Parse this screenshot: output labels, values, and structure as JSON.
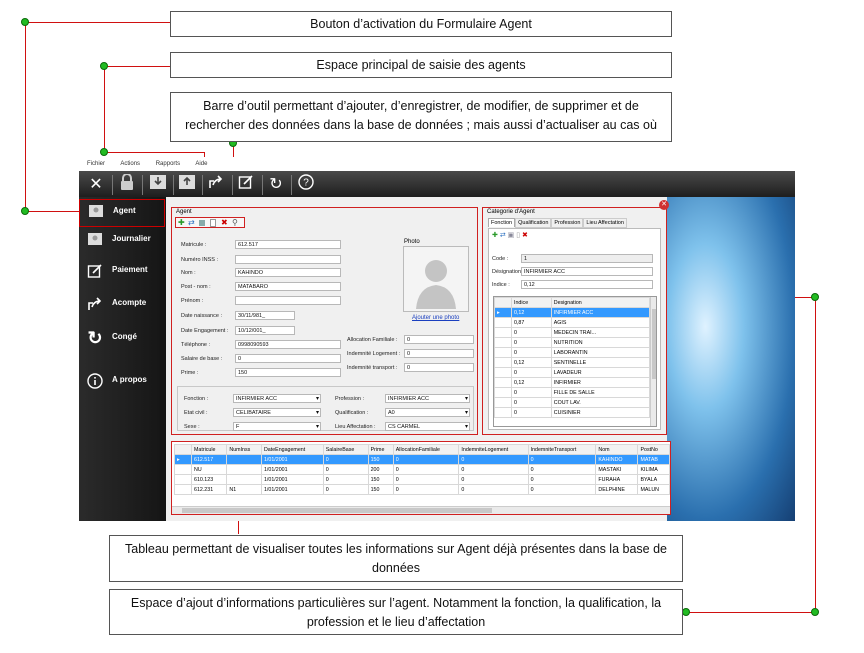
{
  "callouts": {
    "c1": "Bouton d’activation du Formulaire Agent",
    "c2": "Espace principal de saisie des agents",
    "c3_line1": "Barre d’outil permettant d’ajouter,  d’enregistrer, de modifier, de supprimer et de",
    "c3_line2": "rechercher des données dans la base de données ; mais aussi d’actualiser au cas où",
    "c4_line1": "Tableau permettant de visualiser toutes les informations sur Agent déjà présentes dans la base de",
    "c4_line2": "données",
    "c5_line1": "Espace d’ajout d’informations particulières sur l’agent. Notamment la fonction, la qualification, la",
    "c5_line2": "profession et le lieu d’affectation"
  },
  "menu": [
    "Fichier",
    "Actions",
    "Rapports",
    "Aide"
  ],
  "sidebar": {
    "items": [
      {
        "label": "Agent",
        "icon": "agent-icon"
      },
      {
        "label": "Journalier",
        "icon": "journalier-icon"
      },
      {
        "label": "Paiement",
        "icon": "edit-icon"
      },
      {
        "label": "Acompte",
        "icon": "share-icon"
      },
      {
        "label": "Congé",
        "icon": "refresh-icon"
      },
      {
        "label": "A propos",
        "icon": "info-icon"
      }
    ]
  },
  "agent_form": {
    "title": "Agent",
    "photo_title": "Photo",
    "photo_link": "Ajouter une photo",
    "fields": {
      "matricule": {
        "label": "Matricule :",
        "value": "612.517"
      },
      "inss": {
        "label": "Numéro INSS :",
        "value": ""
      },
      "nom": {
        "label": "Nom :",
        "value": "KAHINDO"
      },
      "postnom": {
        "label": "Post - nom :",
        "value": "MATABARO"
      },
      "prenom": {
        "label": "Prénom :",
        "value": ""
      },
      "naissance": {
        "label": "Date naissance :",
        "value": "30/11/981_"
      },
      "engagement": {
        "label": "Date Engagement :",
        "value": "10/12/001_"
      },
      "telephone": {
        "label": "Téléphone :",
        "value": "0998090593"
      },
      "salaire": {
        "label": "Salaire de base :",
        "value": "0"
      },
      "prime": {
        "label": "Prime :",
        "value": "150"
      }
    },
    "allocations": {
      "familiale": {
        "label": "Allocation Familiale :",
        "value": "0"
      },
      "logement": {
        "label": "Indemnité Logement :",
        "value": "0"
      },
      "transport": {
        "label": "Indemnité transport :",
        "value": "0"
      }
    },
    "selects": {
      "fonction": {
        "label": "Fonction :",
        "value": "INFIRMIER ACC"
      },
      "etat_civil": {
        "label": "Etat civil :",
        "value": "CELIBATAIRE"
      },
      "sexe": {
        "label": "Sexe :",
        "value": "F"
      },
      "profession": {
        "label": "Profession :",
        "value": "INFIRMIER ACC"
      },
      "qualification": {
        "label": "Qualification :",
        "value": "A0"
      },
      "lieu": {
        "label": "Lieu Affectation :",
        "value": "CS CARMEL"
      }
    }
  },
  "categorie": {
    "title": "Categorie d'Agent",
    "tabs": [
      "Fonction",
      "Qualification",
      "Profession",
      "Lieu Affectation"
    ],
    "code": {
      "label": "Code :",
      "value": "1"
    },
    "designation": {
      "label": "Désignation :",
      "value": "INFIRMIER ACC"
    },
    "indice": {
      "label": "Indice :",
      "value": "0,12"
    },
    "grid_headers": [
      "Indice",
      "Designation"
    ],
    "grid_rows": [
      [
        "0,12",
        "INFIRMIER ACC"
      ],
      [
        "0,87",
        "AGIS"
      ],
      [
        "0",
        "MEDECIN TRAI..."
      ],
      [
        "0",
        "NUTRITION"
      ],
      [
        "0",
        "LABORANTIN"
      ],
      [
        "0,12",
        "SENTINELLE"
      ],
      [
        "0",
        "LAVADEUR"
      ],
      [
        "0,12",
        "INFIRMIER"
      ],
      [
        "0",
        "FILLE DE SALLE"
      ],
      [
        "0",
        "COUT LAV."
      ],
      [
        "0",
        "CUISINIER"
      ]
    ]
  },
  "agents_table": {
    "headers": [
      "Matricule",
      "NumInss",
      "DateEngagement",
      "SalaireBase",
      "Prime",
      "AllocationFamiliale",
      "IndemniteLogement",
      "IndemniteTransport",
      "Nom",
      "PostNo"
    ],
    "rows": [
      [
        "612.517",
        "",
        "1/01/2001",
        "0",
        "150",
        "0",
        "0",
        "0",
        "KAHINDO",
        "MATAB"
      ],
      [
        "NU",
        "",
        "1/01/2001",
        "0",
        "200",
        "0",
        "0",
        "0",
        "MASTAKI",
        "KILIMA"
      ],
      [
        "610.123",
        "",
        "1/01/2001",
        "0",
        "150",
        "0",
        "0",
        "0",
        "FURAHA",
        "BYALA"
      ],
      [
        "612.231",
        "N1",
        "1/01/2001",
        "0",
        "150",
        "0",
        "0",
        "0",
        "DELPHINE",
        "MALUN"
      ]
    ]
  },
  "colors": {
    "callout_line": "#d01010",
    "dot": "#22bb22",
    "selection": "#3399ff"
  }
}
